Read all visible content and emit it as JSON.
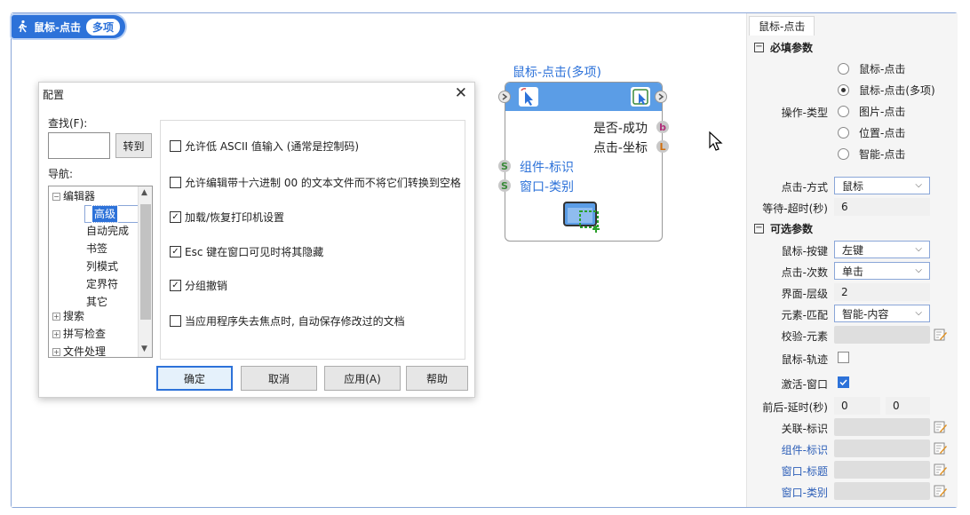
{
  "badge": {
    "title": "鼠标-点击",
    "multi": "多项"
  },
  "dialog": {
    "title": "配置",
    "find_label": "查找(F):",
    "goto": "转到",
    "nav_label": "导航:",
    "tree": [
      {
        "label": "编辑器",
        "exp": "⊟"
      },
      {
        "label": "高级"
      },
      {
        "label": "自动完成"
      },
      {
        "label": "书签"
      },
      {
        "label": "列模式"
      },
      {
        "label": "定界符"
      },
      {
        "label": "其它"
      },
      {
        "label": "搜索",
        "exp": "⊞"
      },
      {
        "label": "拼写检查",
        "exp": "⊞"
      },
      {
        "label": "文件处理",
        "exp": "⊞"
      }
    ],
    "options": [
      {
        "label": "允许低 ASCII 值输入 (通常是控制码)",
        "checked": false
      },
      {
        "label": "允许编辑带十六进制 00 的文本文件而不将它们转换到空格",
        "checked": false
      },
      {
        "label": "加载/恢复打印机设置",
        "checked": true
      },
      {
        "label": "Esc 键在窗口可见时将其隐藏",
        "checked": true
      },
      {
        "label": "分组撤销",
        "checked": true
      },
      {
        "label": "当应用程序失去焦点时, 自动保存修改过的文档",
        "checked": false
      }
    ],
    "buttons": {
      "ok": "确定",
      "cancel": "取消",
      "apply": "应用(A)",
      "help": "帮助"
    }
  },
  "node": {
    "title": "鼠标-点击(多项)",
    "outputs": [
      {
        "label": "是否-成功",
        "port": "b"
      },
      {
        "label": "点击-坐标",
        "port": "L"
      }
    ],
    "inputs": [
      {
        "label": "组件-标识",
        "port": "S"
      },
      {
        "label": "窗口-类别",
        "port": "S"
      }
    ]
  },
  "panel": {
    "tab": "鼠标-点击",
    "required_section": "必填参数",
    "optional_section": "可选参数",
    "op_type_label": "操作-类型",
    "op_types": [
      {
        "label": "鼠标-点击",
        "on": false
      },
      {
        "label": "鼠标-点击(多项)",
        "on": true
      },
      {
        "label": "图片-点击",
        "on": false
      },
      {
        "label": "位置-点击",
        "on": false
      },
      {
        "label": "智能-点击",
        "on": false
      }
    ],
    "click_mode_label": "点击-方式",
    "click_mode": "鼠标",
    "wait_timeout_label": "等待-超时(秒)",
    "wait_timeout": "6",
    "mouse_button_label": "鼠标-按键",
    "mouse_button": "左键",
    "click_count_label": "点击-次数",
    "click_count": "单击",
    "ui_level_label": "界面-层级",
    "ui_level": "2",
    "element_match_label": "元素-匹配",
    "element_match": "智能-内容",
    "verify_label": "校验-元素",
    "trajectory_label": "鼠标-轨迹",
    "activate_label": "激活-窗口",
    "delay_label": "前后-延时(秒)",
    "delay_before": "0",
    "delay_after": "0",
    "link_id_label": "关联-标识",
    "comp_id_label": "组件-标识",
    "win_title_label": "窗口-标题",
    "win_class_label": "窗口-类别"
  },
  "colors": {
    "accent": "#2d72d9",
    "node_head": "#5b9de6"
  }
}
